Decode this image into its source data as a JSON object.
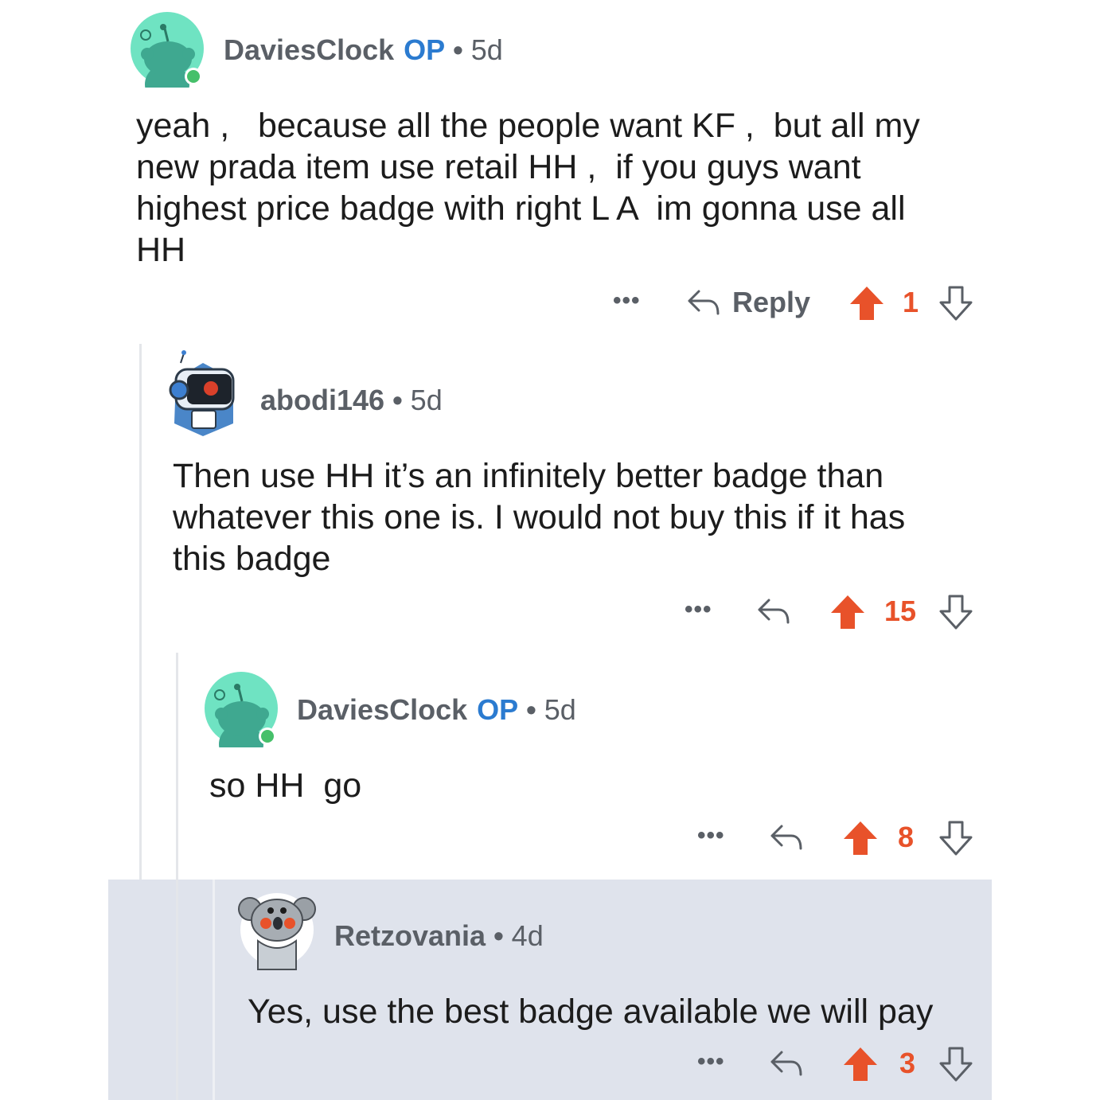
{
  "colors": {
    "accent_upvote": "#e8522a",
    "op_badge": "#2b7bd0",
    "muted": "#5a5f66",
    "highlight_bg": "#dfe3ec",
    "online_dot": "#46c06a"
  },
  "icons": {
    "more": "more-icon",
    "reply": "reply-icon",
    "upvote": "upvote-icon",
    "downvote": "downvote-icon"
  },
  "comments": [
    {
      "username": "DaviesClock",
      "op_badge": "OP",
      "separator": "•",
      "age": "5d",
      "body": "yeah ,   because all the people want KF ,  but all my\nnew prada item use retail HH ,  if you guys want\nhighest price badge with right L A  im gonna use all\nHH",
      "more": "•••",
      "reply_label": "Reply",
      "score": "1"
    },
    {
      "username": "abodi146",
      "separator": "•",
      "age": "5d",
      "body": "Then use HH it’s an infinitely better badge than\nwhatever this one is. I would not buy this if it has\nthis badge",
      "more": "•••",
      "score": "15"
    },
    {
      "username": "DaviesClock",
      "op_badge": "OP",
      "separator": "•",
      "age": "5d",
      "body": "so HH  go",
      "more": "•••",
      "score": "8"
    },
    {
      "username": "Retzovania",
      "separator": "•",
      "age": "4d",
      "body": "Yes, use the best badge available we will pay",
      "more": "•••",
      "score": "3"
    }
  ]
}
